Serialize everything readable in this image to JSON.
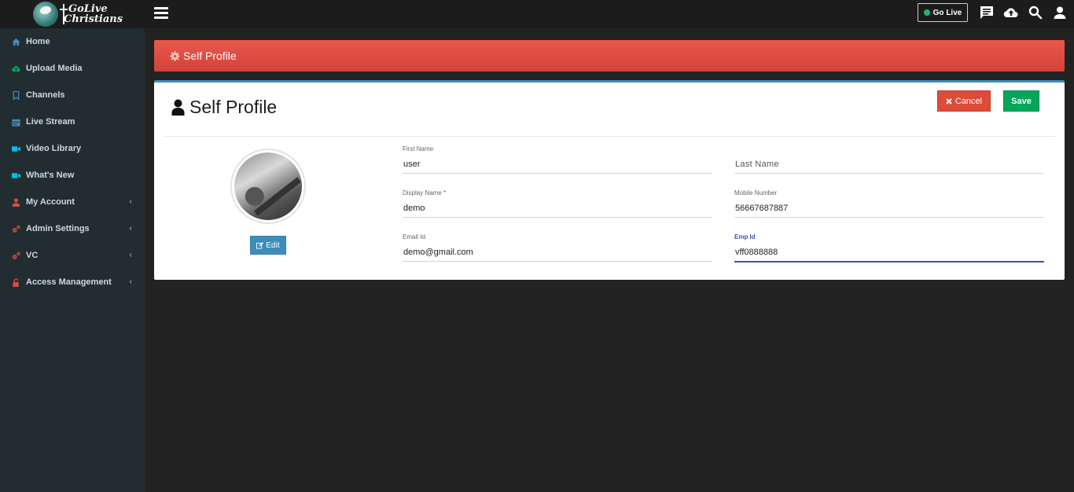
{
  "brand": {
    "line1": "GoLive",
    "line2": "Christians"
  },
  "topbar": {
    "go_live_label": "Go Live",
    "icons": [
      "chat-icon",
      "cloud-upload-icon",
      "search-icon",
      "user-icon"
    ]
  },
  "sidebar": {
    "items": [
      {
        "label": "Home",
        "icon": "home-icon",
        "color": "#3c8dbc"
      },
      {
        "label": "Upload Media",
        "icon": "cloud-upload-icon",
        "color": "#00a65a"
      },
      {
        "label": "Channels",
        "icon": "bookmark-icon",
        "color": "#3c8dbc"
      },
      {
        "label": "Live Stream",
        "icon": "calendar-icon",
        "color": "#3c8dbc"
      },
      {
        "label": "Video Library",
        "icon": "video-icon",
        "color": "#00c0ef"
      },
      {
        "label": "What's New",
        "icon": "video-icon",
        "color": "#00c0ef"
      },
      {
        "label": "My Account",
        "icon": "user-icon",
        "color": "#dd4b39",
        "chevron": "‹"
      },
      {
        "label": "Admin Settings",
        "icon": "cogs-icon",
        "color": "#dd4b39",
        "chevron": "‹"
      },
      {
        "label": "VC",
        "icon": "cogs-icon",
        "color": "#dd4b39",
        "chevron": "‹"
      },
      {
        "label": "Access Management",
        "icon": "unlock-icon",
        "color": "#dd4b39",
        "chevron": "‹"
      }
    ]
  },
  "banner": {
    "title": "Self Profile"
  },
  "profile": {
    "title": "Self Profile",
    "cancel_label": "Cancel",
    "save_label": "Save",
    "edit_label": "Edit",
    "fields": {
      "first_name": {
        "label": "First Name",
        "value": "user"
      },
      "last_name": {
        "placeholder": "Last Name",
        "value": ""
      },
      "display_name": {
        "label": "Display Name *",
        "value": "demo"
      },
      "mobile": {
        "label": "Mobile Number",
        "value": "56667687887"
      },
      "email": {
        "label": "Email Id",
        "value": "demo@gmail.com"
      },
      "emp_id": {
        "label": "Emp Id",
        "value": "vff0888888"
      }
    }
  },
  "colors": {
    "banner": "#dd4b39",
    "cancel": "#dd4b39",
    "save": "#00a65a",
    "edit": "#3c8dbc",
    "focus": "#3f51b5",
    "sidebar_bg": "#222d32"
  }
}
